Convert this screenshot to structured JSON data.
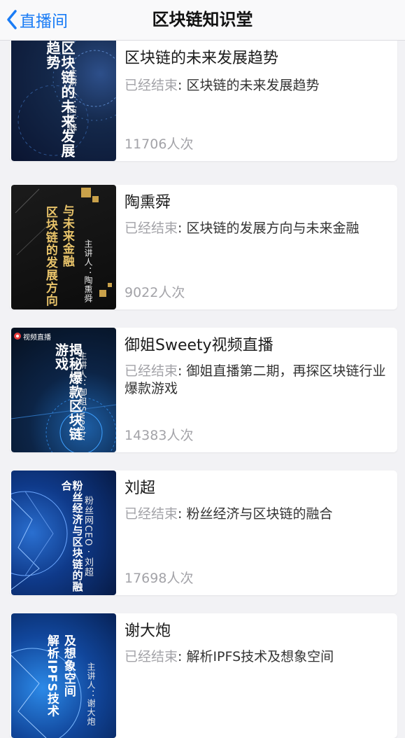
{
  "nav": {
    "back_label": "直播间",
    "title": "区块链知识堂"
  },
  "items": [
    {
      "title": "区块链的未来发展趋势",
      "status": "已经结束",
      "description": ": 区块链的未来发展趋势",
      "views": "11706人次",
      "cover": {
        "title": "区块链的未来发展趋势",
        "subtitle": "主讲人：古千峰"
      }
    },
    {
      "title": "陶熏舜",
      "status": "已经结束",
      "description": ": 区块链的发展方向与未来金融",
      "views": "9022人次",
      "cover": {
        "title": "与未来金融",
        "title2": "区块链的发展方向",
        "subtitle": "主讲人：陶熏舜"
      }
    },
    {
      "title": "御姐Sweety视频直播",
      "status": "已经结束",
      "description": ": 御姐直播第二期，再探区块链行业爆款游戏",
      "views": "14383人次",
      "cover": {
        "badge": "视频直播",
        "title": "揭秘爆款区块链游戏",
        "subtitle": "主讲人：御姐Sweety"
      }
    },
    {
      "title": "刘超",
      "status": "已经结束",
      "description": ": 粉丝经济与区块链的融合",
      "views": "17698人次",
      "cover": {
        "title": "粉丝经济与区块链的融合",
        "subtitle": "粉丝网CEO · 刘超"
      }
    },
    {
      "title": "谢大炮",
      "status": "已经结束",
      "description": ": 解析IPFS技术及想象空间",
      "views": "",
      "cover": {
        "title": "及想象空间",
        "title2": "解析IPFS技术",
        "subtitle": "主讲人：谢大炮"
      }
    }
  ],
  "colors": {
    "accent": "#1a7cf5",
    "muted": "#a3a3a8",
    "background": "#f2f2f5"
  }
}
